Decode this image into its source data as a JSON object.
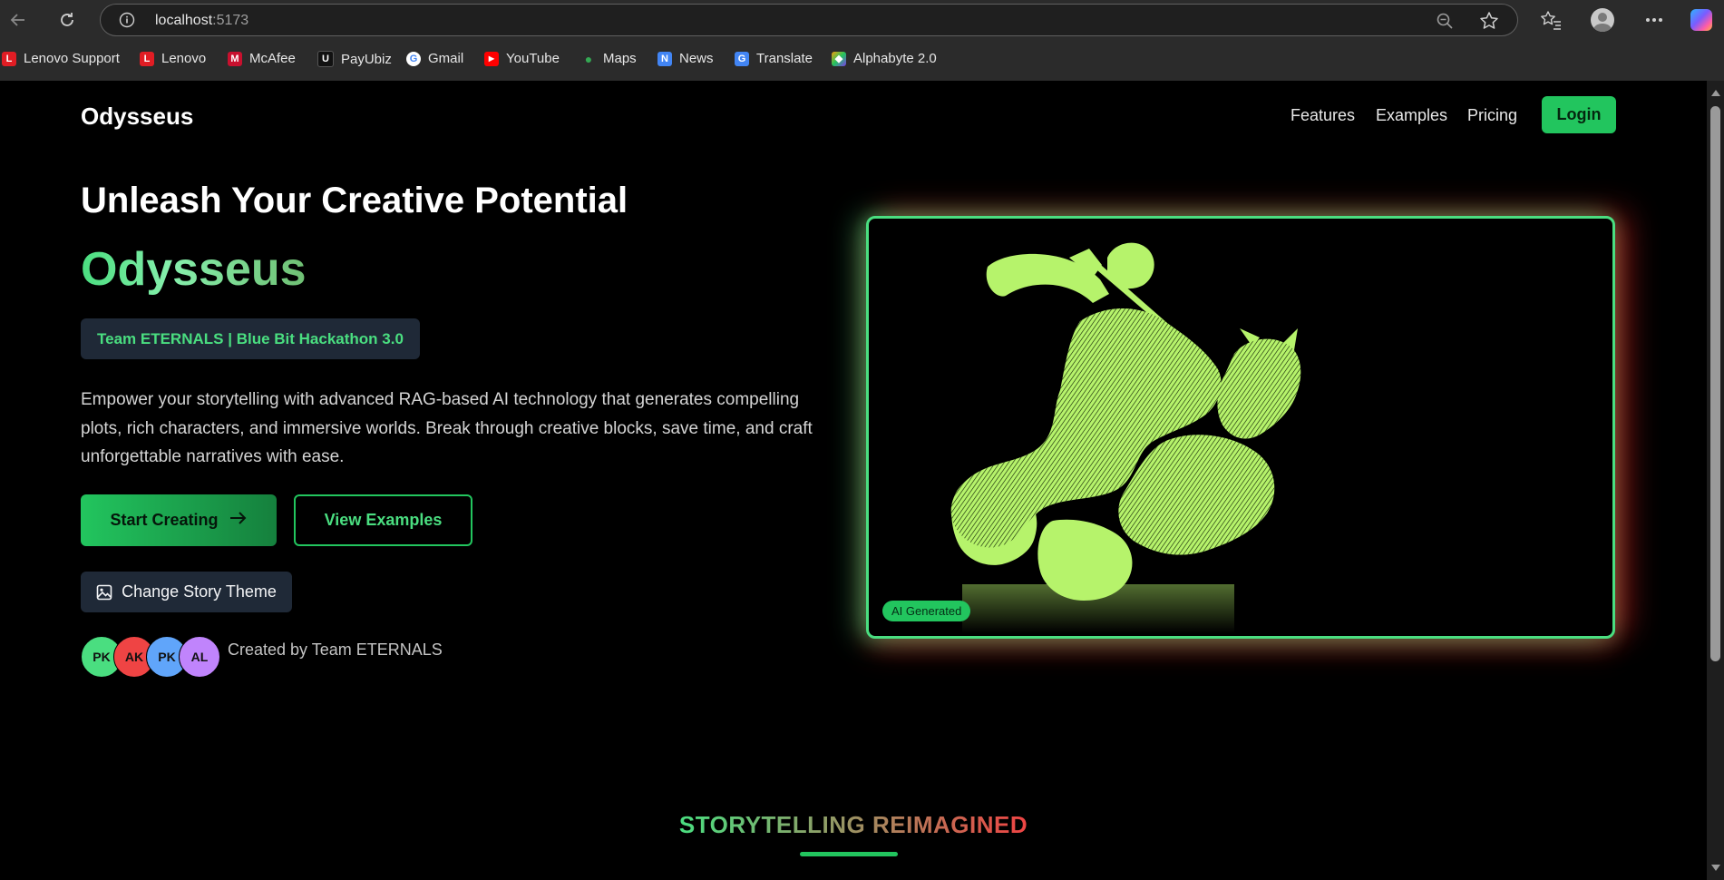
{
  "browser": {
    "url_host": "localhost",
    "url_port": ":5173",
    "bookmarks": [
      {
        "label": "Lenovo Support",
        "icon": "L",
        "color": "#e11d24"
      },
      {
        "label": "Lenovo",
        "icon": "L",
        "color": "#e11d24"
      },
      {
        "label": "McAfee",
        "icon": "M",
        "color": "#c8102e"
      },
      {
        "label": "PayUbiz",
        "icon": "U",
        "color": "#111111"
      },
      {
        "label": "Gmail",
        "icon": "G",
        "color": "#ffffff"
      },
      {
        "label": "YouTube",
        "icon": "▶",
        "color": "#ff0000"
      },
      {
        "label": "Maps",
        "icon": "●",
        "color": "#34a853"
      },
      {
        "label": "News",
        "icon": "N",
        "color": "#4285f4"
      },
      {
        "label": "Translate",
        "icon": "G",
        "color": "#4285f4"
      },
      {
        "label": "Alphabyte 2.0",
        "icon": "◆",
        "color": "#7c3aed"
      }
    ]
  },
  "header": {
    "brand": "Odysseus",
    "nav": [
      "Features",
      "Examples",
      "Pricing"
    ],
    "login": "Login"
  },
  "hero": {
    "title": "Unleash Your Creative Potential",
    "subtitle": "Odysseus",
    "badge": "Team ETERNALS | Blue Bit Hackathon 3.0",
    "description": "Empower your storytelling with advanced RAG-based AI technology that generates compelling plots, rich characters, and immersive worlds. Break through creative blocks, save time, and craft unforgettable narratives with ease.",
    "primary_button": "Start Creating",
    "secondary_button": "View Examples",
    "theme_button": "Change Story Theme",
    "avatars": [
      {
        "initials": "PK",
        "color": "#4ade80"
      },
      {
        "initials": "AK",
        "color": "#ef4444"
      },
      {
        "initials": "PK",
        "color": "#60a5fa"
      },
      {
        "initials": "AL",
        "color": "#c084fc"
      }
    ],
    "created_by": "Created by Team ETERNALS",
    "image_badge": "AI Generated"
  },
  "section": {
    "title": "STORYTELLING REIMAGINED"
  },
  "colors": {
    "accent": "#22c55e",
    "accent_light": "#4ade80",
    "glow_red": "#dc2626"
  }
}
